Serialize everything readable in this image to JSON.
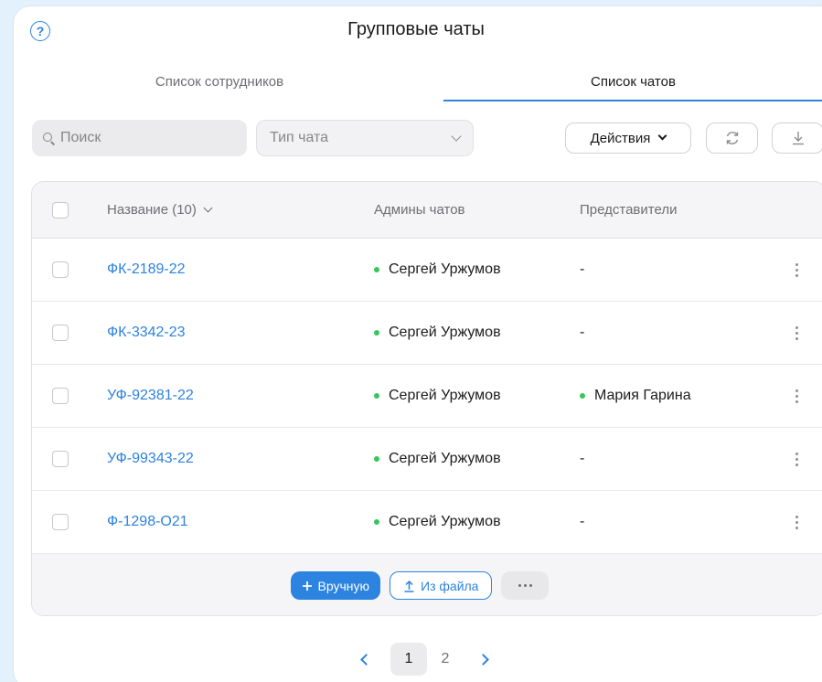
{
  "header": {
    "title": "Групповые чаты"
  },
  "tabs": [
    {
      "label": "Список сотрудников",
      "active": false
    },
    {
      "label": "Список чатов",
      "active": true
    }
  ],
  "toolbar": {
    "search_placeholder": "Поиск",
    "chat_type_placeholder": "Тип чата",
    "actions_label": "Действия"
  },
  "table": {
    "columns": {
      "name": "Название (10)",
      "admins": "Админы чатов",
      "reps": "Представители"
    },
    "rows": [
      {
        "name": "ФК-2189-22",
        "admin": "Сергей Уржумов",
        "rep": "-"
      },
      {
        "name": "ФК-3342-23",
        "admin": "Сергей Уржумов",
        "rep": "-"
      },
      {
        "name": "УФ-92381-22",
        "admin": "Сергей Уржумов",
        "rep": "Мария Гарина"
      },
      {
        "name": "УФ-99343-22",
        "admin": "Сергей Уржумов",
        "rep": "-"
      },
      {
        "name": "Ф-1298-О21",
        "admin": "Сергей Уржумов",
        "rep": "-"
      }
    ],
    "footer": {
      "manual_label": "Вручную",
      "file_label": "Из файла"
    }
  },
  "pagination": {
    "pages": [
      "1",
      "2"
    ],
    "current": "1"
  },
  "colors": {
    "accent": "#2c83e0",
    "status_dot": "#34c759",
    "background": "#e3f1fd"
  }
}
